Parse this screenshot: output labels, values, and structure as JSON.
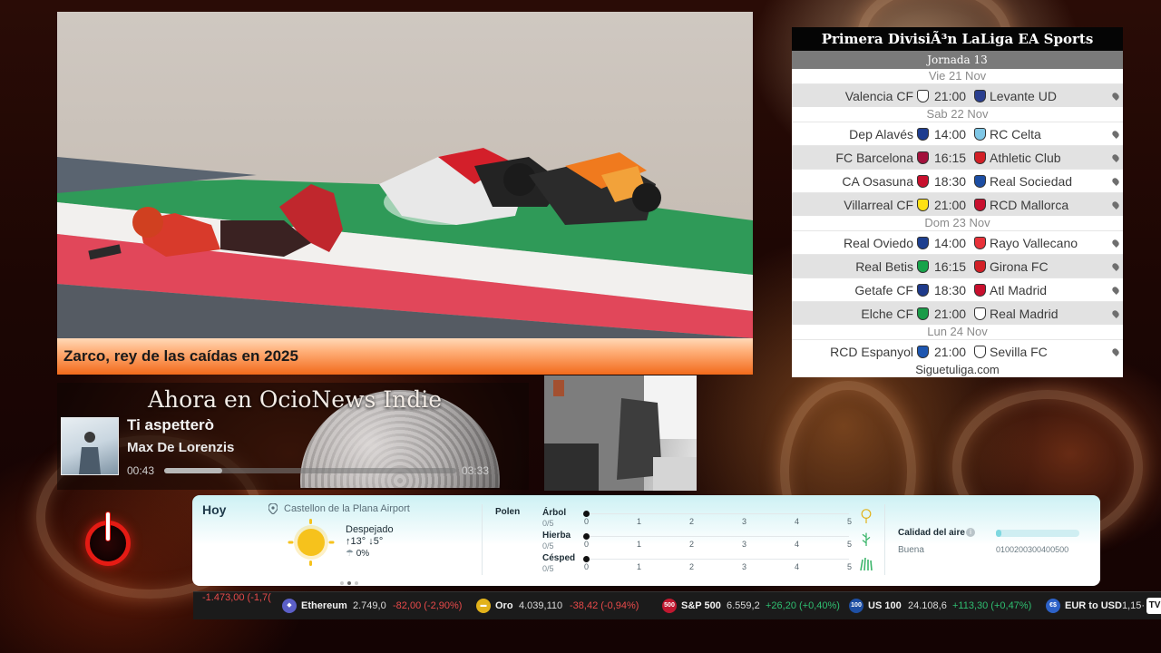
{
  "news": {
    "caption": "Zarco, rey de las caídas en 2025"
  },
  "now_playing": {
    "heading": "Ahora en OcioNews Indie",
    "title": "Ti aspetterò",
    "artist": "Max De Lorenzis",
    "elapsed": "00:43",
    "total": "03:33",
    "progress_fraction": 0.2
  },
  "liga": {
    "title": "Primera DivisiÃ³n LaLiga EA Sports",
    "round": "Jornada 13",
    "days": [
      {
        "label": "Vie 21 Nov",
        "matches": [
          {
            "home": "Valencia CF",
            "time": "21:00",
            "away": "Levante UD",
            "home_color": "#ffffff",
            "away_color": "#2b3f8f"
          }
        ]
      },
      {
        "label": "Sab 22 Nov",
        "matches": [
          {
            "home": "Dep Alavés",
            "time": "14:00",
            "away": "RC Celta",
            "home_color": "#1e3d8f",
            "away_color": "#7fc7e6"
          },
          {
            "home": "FC Barcelona",
            "time": "16:15",
            "away": "Athletic Club",
            "home_color": "#a3113c",
            "away_color": "#d21f26"
          },
          {
            "home": "CA Osasuna",
            "time": "18:30",
            "away": "Real Sociedad",
            "home_color": "#c8102e",
            "away_color": "#1d4ea3"
          },
          {
            "home": "Villarreal CF",
            "time": "21:00",
            "away": "RCD Mallorca",
            "home_color": "#ffe114",
            "away_color": "#c8102e"
          }
        ]
      },
      {
        "label": "Dom 23 Nov",
        "matches": [
          {
            "home": "Real Oviedo",
            "time": "14:00",
            "away": "Rayo Vallecano",
            "home_color": "#1d3f8f",
            "away_color": "#e8323a"
          },
          {
            "home": "Real Betis",
            "time": "16:15",
            "away": "Girona FC",
            "home_color": "#17a34a",
            "away_color": "#d21f26"
          },
          {
            "home": "Getafe CF",
            "time": "18:30",
            "away": "Atl Madrid",
            "home_color": "#1e3a8a",
            "away_color": "#c8102e"
          },
          {
            "home": "Elche CF",
            "time": "21:00",
            "away": "Real Madrid",
            "home_color": "#1a9b48",
            "away_color": "#ffffff"
          }
        ]
      },
      {
        "label": "Lun 24 Nov",
        "matches": [
          {
            "home": "RCD Espanyol",
            "time": "21:00",
            "away": "Sevilla FC",
            "home_color": "#1d56b0",
            "away_color": "#ffffff"
          }
        ]
      }
    ],
    "footer": "Siguetuliga.com"
  },
  "weather": {
    "today_label": "Hoy",
    "location": "Castellon de la Plana Airport",
    "condition": "Despejado",
    "high": "13°",
    "low": "5°",
    "rain": "0%",
    "pollen_label": "Polen",
    "pollen": [
      {
        "name": "Árbol",
        "score": "0/5",
        "level": 0
      },
      {
        "name": "Hierba",
        "score": "0/5",
        "level": 0
      },
      {
        "name": "Césped",
        "score": "0/5",
        "level": 0
      }
    ],
    "pollen_ticks": [
      "0",
      "1",
      "2",
      "3",
      "4",
      "5"
    ],
    "air_quality_label": "Calidad del aire",
    "air_quality_value": "Buena",
    "air_quality_scale": "0100200300400500",
    "air_quality_level": 0.05
  },
  "ticker": {
    "items": [
      {
        "name": "",
        "value": "",
        "change": "-1.473,00 (-1,7(",
        "direction": "down",
        "icon": ""
      },
      {
        "name": "Ethereum",
        "value": "2.749,0",
        "change": "-82,00 (-2,90%)",
        "direction": "down",
        "icon": "ethereum-icon",
        "icon_text": "◆",
        "icon_color": "#5b5fc7"
      },
      {
        "name": "Oro",
        "value": "4.039,110",
        "change": "-38,42 (-0,94%)",
        "direction": "down",
        "icon": "gold-icon",
        "icon_text": "▬",
        "icon_color": "#e2b21a"
      },
      {
        "name": "S&P 500",
        "value": "6.559,2",
        "change": "+26,20 (+0,40%)",
        "direction": "up",
        "icon": "sp500-icon",
        "icon_text": "500",
        "icon_color": "#c01830"
      },
      {
        "name": "US 100",
        "value": "24.108,6",
        "change": "+113,30 (+0,47%)",
        "direction": "up",
        "icon": "us100-icon",
        "icon_text": "100",
        "icon_color": "#1e4fa3"
      },
      {
        "name": "EUR to USD",
        "value": "1,15·",
        "change": "",
        "direction": "",
        "icon": "eurusd-icon",
        "icon_text": "€$",
        "icon_color": "#2d62c8"
      }
    ],
    "brand": "TV"
  }
}
